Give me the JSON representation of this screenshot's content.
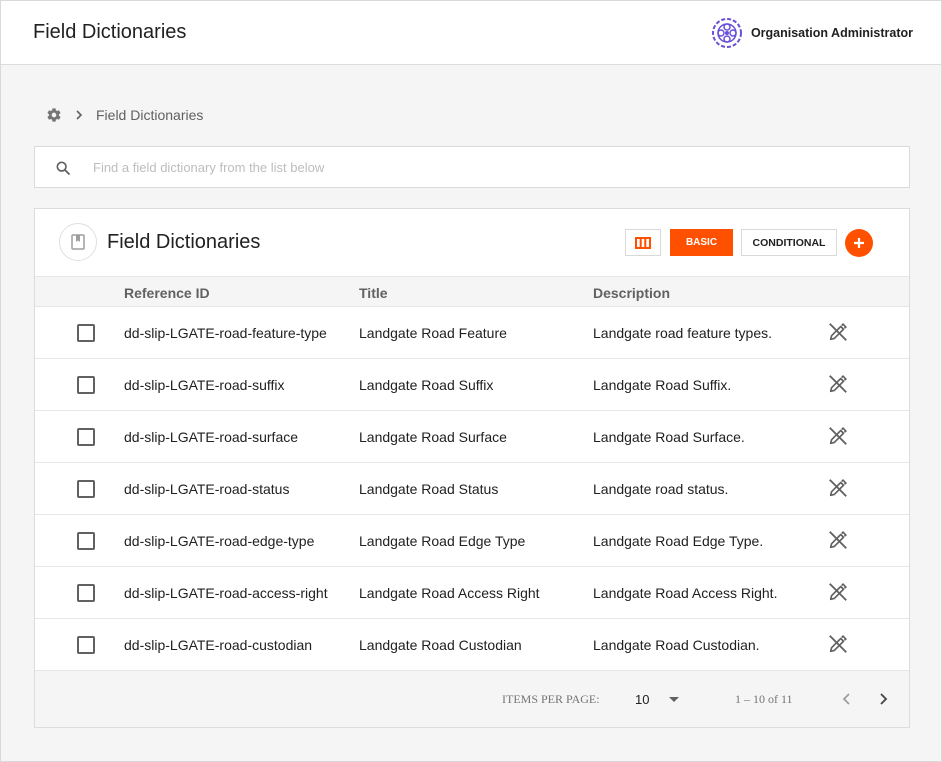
{
  "header": {
    "title": "Field Dictionaries",
    "user_name": "Organisation Administrator",
    "logo_icon": "organisation-logo-icon"
  },
  "breadcrumb": {
    "home_icon": "gear-icon",
    "separator_icon": "chevron-right-icon",
    "current": "Field Dictionaries"
  },
  "search": {
    "placeholder": "Find a field dictionary from the list below",
    "value": ""
  },
  "card": {
    "title": "Field Dictionaries",
    "icon": "book-icon",
    "toolbar": {
      "columns_icon": "view-columns-icon",
      "basic_label": "BASIC",
      "conditional_label": "CONDITIONAL",
      "add_icon": "plus-icon"
    }
  },
  "table": {
    "columns": [
      "Reference ID",
      "Title",
      "Description"
    ],
    "rows": [
      {
        "ref": "dd-slip-LGATE-road-feature-type",
        "title": "Landgate Road Feature",
        "desc": "Landgate road feature types."
      },
      {
        "ref": "dd-slip-LGATE-road-suffix",
        "title": "Landgate Road Suffix",
        "desc": "Landgate Road Suffix."
      },
      {
        "ref": "dd-slip-LGATE-road-surface",
        "title": "Landgate Road Surface",
        "desc": "Landgate Road Surface."
      },
      {
        "ref": "dd-slip-LGATE-road-status",
        "title": "Landgate Road Status",
        "desc": "Landgate road status."
      },
      {
        "ref": "dd-slip-LGATE-road-edge-type",
        "title": "Landgate Road Edge Type",
        "desc": "Landgate Road Edge Type."
      },
      {
        "ref": "dd-slip-LGATE-road-access-right",
        "title": "Landgate Road Access Right",
        "desc": "Landgate Road Access Right."
      },
      {
        "ref": "dd-slip-LGATE-road-custodian",
        "title": "Landgate Road Custodian",
        "desc": "Landgate Road Custodian."
      }
    ],
    "row_action_icon": "edit-off-icon"
  },
  "paginator": {
    "items_per_page_label": "ITEMS PER PAGE:",
    "items_per_page_value": "10",
    "range_label": "1 – 10 of 11"
  },
  "colors": {
    "accent": "#ff5000",
    "logo": "#6a4fd8"
  }
}
